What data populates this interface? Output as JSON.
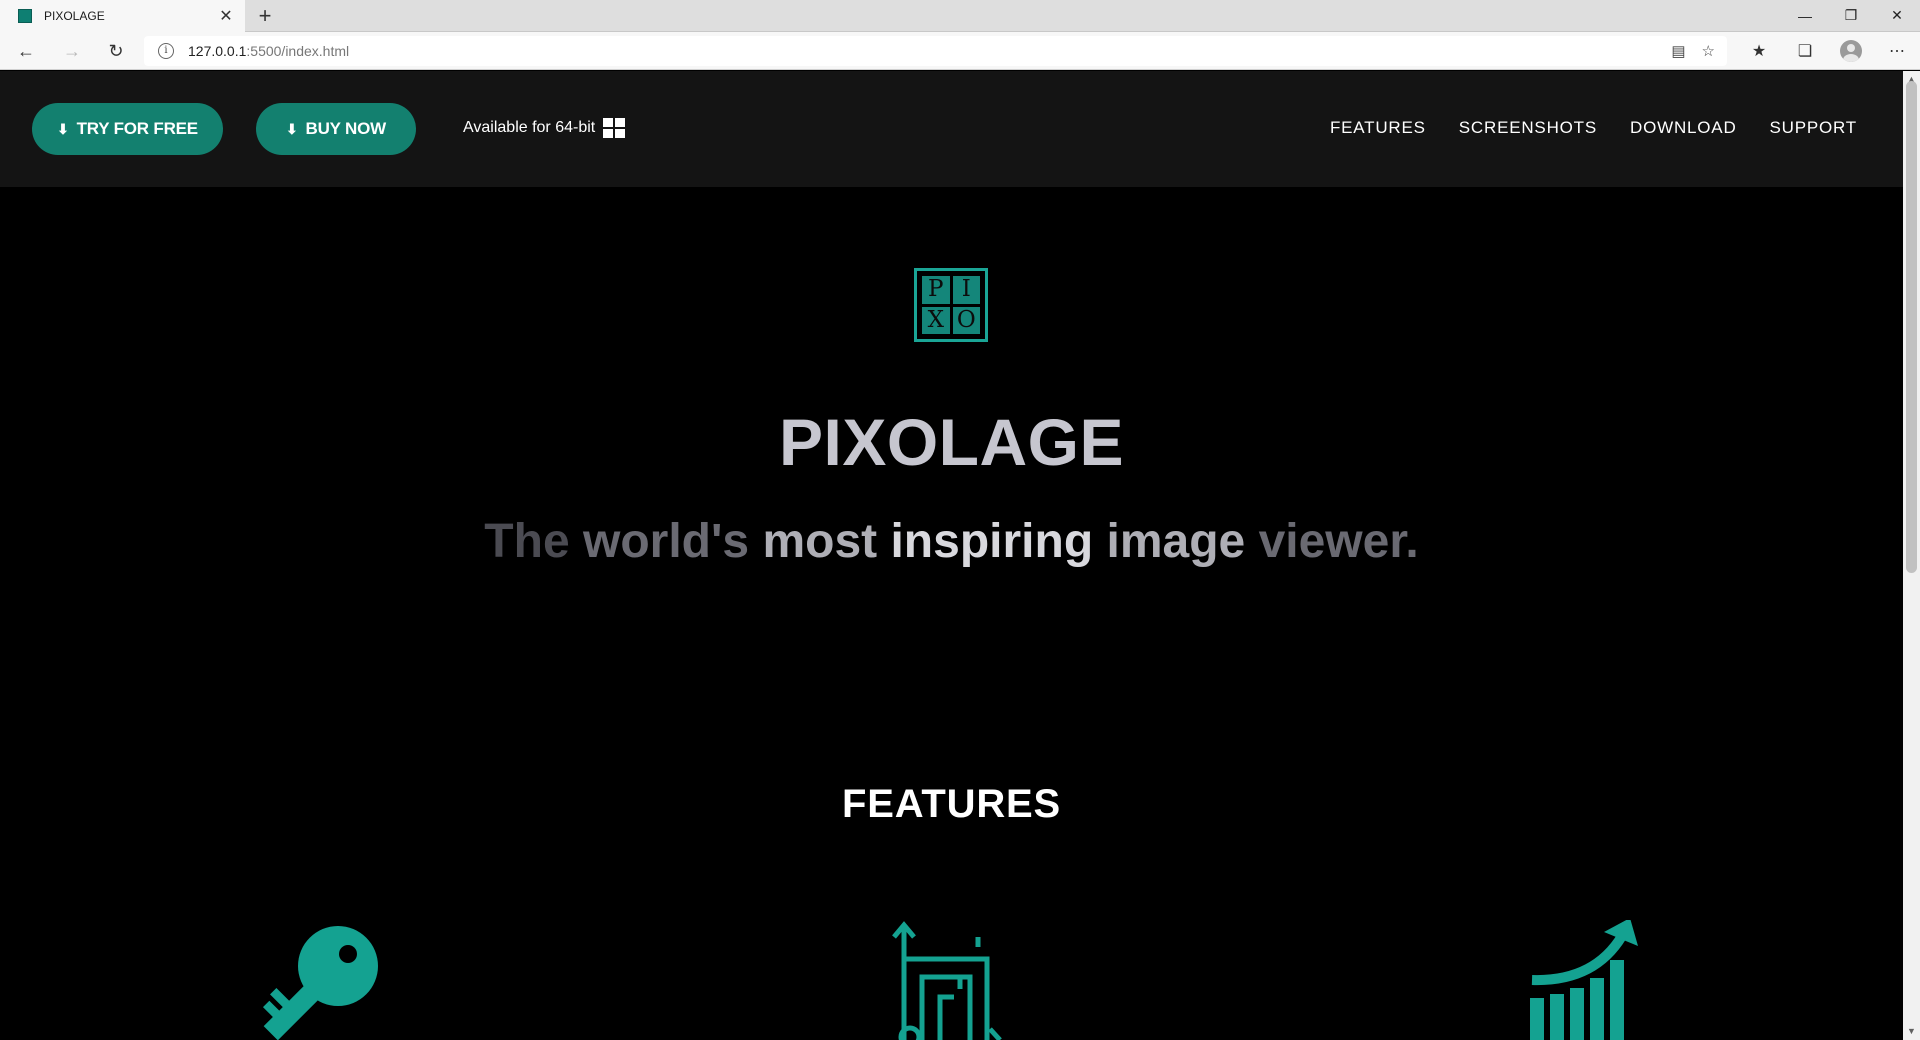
{
  "browser": {
    "tab_title": "PIXOLAGE",
    "url_host": "127.0.0.1",
    "url_path": ":5500/index.html"
  },
  "header": {
    "try_label": "TRY FOR FREE",
    "buy_label": "BUY NOW",
    "availability": "Available for 64-bit",
    "nav": [
      "FEATURES",
      "SCREENSHOTS",
      "DOWNLOAD",
      "SUPPORT"
    ]
  },
  "logo": {
    "letters": [
      "P",
      "I",
      "X",
      "O"
    ]
  },
  "hero": {
    "title": "PIXOLAGE",
    "tagline_words": [
      "The",
      "world's",
      "most",
      "inspiring",
      "image",
      "viewer."
    ]
  },
  "features": {
    "heading": "FEATURES"
  },
  "colors": {
    "accent": "#13806f",
    "header_bg": "#141414",
    "page_bg": "#000000"
  },
  "icons": [
    "download-icon",
    "windows-icon",
    "key-icon",
    "blueprint-icon",
    "growth-chart-icon"
  ]
}
